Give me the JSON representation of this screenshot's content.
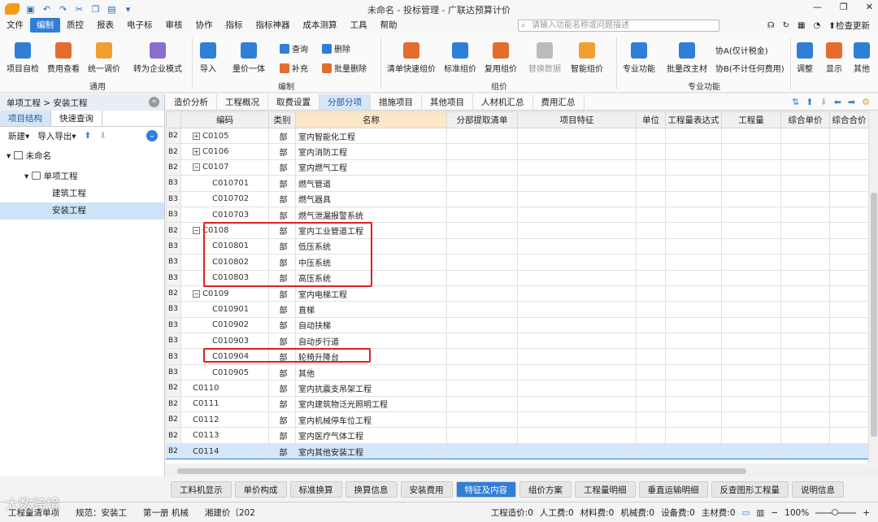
{
  "titlebar": {
    "title": "未命名 - 投标管理 - 广联达预算计价"
  },
  "menubar": {
    "items": [
      "文件",
      "编制",
      "质控",
      "报表",
      "电子标",
      "审核",
      "协作",
      "指标",
      "指标神器",
      "成本测算",
      "工具",
      "帮助"
    ],
    "search_placeholder": "请输入功能名称或问题描述",
    "check_update": "检查更新"
  },
  "ribbon": {
    "groups": [
      "通用",
      "编制",
      "组价",
      "专业功能"
    ],
    "buttons": {
      "b1": "项目自检",
      "b2": "费用查看",
      "b3": "统一调价",
      "b4": "转为企业模式",
      "b5": "导入",
      "b6": "量价一体",
      "s1": "查询",
      "s2": "补充",
      "s3": "删除",
      "s4": "批量删除",
      "b7": "清单快速组价",
      "b8": "标准组价",
      "b9": "复用组价",
      "b10": "替换数据",
      "b11": "智能组价",
      "b12": "专业功能",
      "b13": "批量改主材",
      "s5": "协A(仅计税金)",
      "s6": "协B(不计任何费用)",
      "b14": "调整",
      "b15": "显示",
      "b16": "其他"
    }
  },
  "left_panel": {
    "header": "单项工程 > 安装工程",
    "tabs": [
      "项目结构",
      "快速查询"
    ],
    "tools": {
      "new": "新建",
      "import_export": "导入导出"
    },
    "tree": {
      "root": "未命名",
      "child": "单项工程",
      "leaf1": "建筑工程",
      "leaf2": "安装工程"
    }
  },
  "main_tabs": [
    "造价分析",
    "工程概况",
    "取费设置",
    "分部分项",
    "措施项目",
    "其他项目",
    "人材机汇总",
    "费用汇总"
  ],
  "grid": {
    "columns": [
      "编码",
      "类别",
      "名称",
      "分部提取清单",
      "项目特征",
      "单位",
      "工程量表达式",
      "工程量",
      "综合单价",
      "综合合价"
    ],
    "rows": [
      {
        "lv": "B2",
        "code": "C0105",
        "cat": "部",
        "name": "室内智能化工程",
        "exp": "+"
      },
      {
        "lv": "B2",
        "code": "C0106",
        "cat": "部",
        "name": "室内消防工程",
        "exp": "+"
      },
      {
        "lv": "B2",
        "code": "C0107",
        "cat": "部",
        "name": "室内燃气工程",
        "exp": "−"
      },
      {
        "lv": "B3",
        "code": "C010701",
        "cat": "部",
        "name": "燃气管道",
        "exp": ""
      },
      {
        "lv": "B3",
        "code": "C010702",
        "cat": "部",
        "name": "燃气器具",
        "exp": ""
      },
      {
        "lv": "B3",
        "code": "C010703",
        "cat": "部",
        "name": "燃气泄漏报警系统",
        "exp": ""
      },
      {
        "lv": "B2",
        "code": "C0108",
        "cat": "部",
        "name": "室内工业管道工程",
        "exp": "−"
      },
      {
        "lv": "B3",
        "code": "C010801",
        "cat": "部",
        "name": "低压系统",
        "exp": ""
      },
      {
        "lv": "B3",
        "code": "C010802",
        "cat": "部",
        "name": "中压系统",
        "exp": ""
      },
      {
        "lv": "B3",
        "code": "C010803",
        "cat": "部",
        "name": "高压系统",
        "exp": ""
      },
      {
        "lv": "B2",
        "code": "C0109",
        "cat": "部",
        "name": "室内电梯工程",
        "exp": "−"
      },
      {
        "lv": "B3",
        "code": "C010901",
        "cat": "部",
        "name": "直梯",
        "exp": ""
      },
      {
        "lv": "B3",
        "code": "C010902",
        "cat": "部",
        "name": "自动扶梯",
        "exp": ""
      },
      {
        "lv": "B3",
        "code": "C010903",
        "cat": "部",
        "name": "自动步行道",
        "exp": ""
      },
      {
        "lv": "B3",
        "code": "C010904",
        "cat": "部",
        "name": "轮椅升降台",
        "exp": ""
      },
      {
        "lv": "B3",
        "code": "C010905",
        "cat": "部",
        "name": "其他",
        "exp": ""
      },
      {
        "lv": "B2",
        "code": "C0110",
        "cat": "部",
        "name": "室内抗震支吊架工程",
        "exp": ""
      },
      {
        "lv": "B2",
        "code": "C0111",
        "cat": "部",
        "name": "室内建筑物泛光照明工程",
        "exp": ""
      },
      {
        "lv": "B2",
        "code": "C0112",
        "cat": "部",
        "name": "室内机械停车位工程",
        "exp": ""
      },
      {
        "lv": "B2",
        "code": "C0113",
        "cat": "部",
        "name": "室内医疗气体工程",
        "exp": ""
      },
      {
        "lv": "B2",
        "code": "C0114",
        "cat": "部",
        "name": "室内其他安装工程",
        "exp": ""
      }
    ]
  },
  "bottom_tabs": [
    "工料机显示",
    "单价构成",
    "标准换算",
    "换算信息",
    "安装费用",
    "特征及内容",
    "组价方案",
    "工程量明细",
    "垂直运输明细",
    "反查图形工程量",
    "说明信息"
  ],
  "statusbar": {
    "s1": "工程量清单项",
    "s2": "规范：安装工",
    "s3": "第一册 机械",
    "s4": "湘建价〔202",
    "s5": "工程造价:0",
    "s6": "人工费:0",
    "s7": "材料费:0",
    "s8": "机械费:0",
    "s9": "设备费:0",
    "s10": "主材费:0",
    "zoom": "100%"
  },
  "watermark": "大数跨境"
}
